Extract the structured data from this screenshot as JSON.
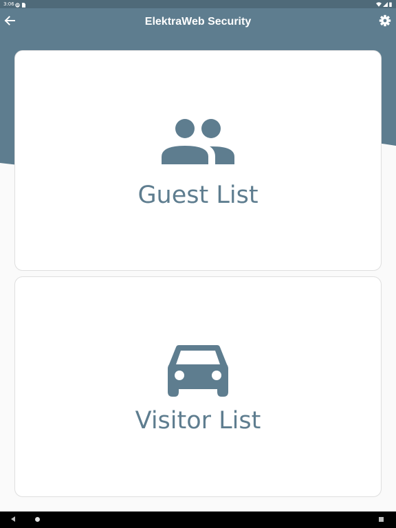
{
  "status_bar": {
    "time": "3:06",
    "left_icons": [
      "notification-icon",
      "sim-card-icon"
    ],
    "right_icons": [
      "wifi-icon",
      "signal-icon",
      "battery-icon"
    ]
  },
  "app_bar": {
    "title": "ElektraWeb Security",
    "back_icon": "arrow-back-icon",
    "settings_icon": "gear-icon"
  },
  "cards": [
    {
      "label": "Guest List",
      "icon": "people-icon"
    },
    {
      "label": "Visitor List",
      "icon": "car-icon"
    }
  ],
  "nav_bar": {
    "buttons": [
      "back-triangle",
      "home-circle",
      "recents-square"
    ]
  },
  "colors": {
    "status_bar": "#4f6a79",
    "header": "#5e7d8f",
    "accent": "#5e7d8f",
    "background": "#fafafa",
    "card": "#ffffff",
    "nav_bar": "#000000"
  }
}
